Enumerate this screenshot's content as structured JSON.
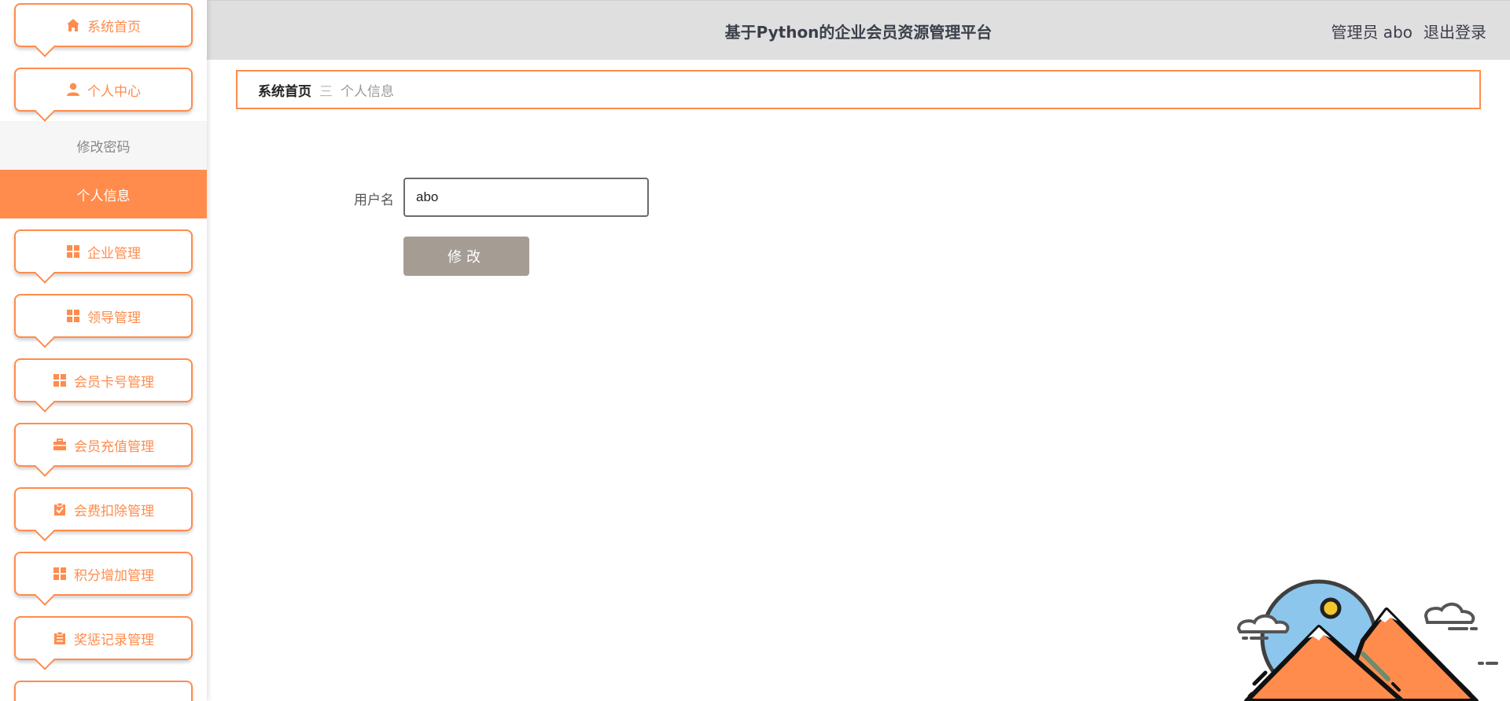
{
  "sidebar": {
    "items": [
      {
        "label": "系统首页",
        "icon": "home-icon"
      },
      {
        "label": "个人中心",
        "icon": "user-icon"
      },
      {
        "label": "企业管理",
        "icon": "grid-icon"
      },
      {
        "label": "领导管理",
        "icon": "grid-icon"
      },
      {
        "label": "会员卡号管理",
        "icon": "grid-icon"
      },
      {
        "label": "会员充值管理",
        "icon": "briefcase-icon"
      },
      {
        "label": "会费扣除管理",
        "icon": "clipboard-check-icon"
      },
      {
        "label": "积分增加管理",
        "icon": "grid-icon"
      },
      {
        "label": "奖惩记录管理",
        "icon": "clipboard-icon"
      }
    ],
    "subitems": [
      {
        "label": "修改密码",
        "active": false
      },
      {
        "label": "个人信息",
        "active": true
      }
    ]
  },
  "header": {
    "title": "基于Python的企业会员资源管理平台",
    "user": "管理员 abo",
    "logout": "退出登录"
  },
  "breadcrumb": {
    "home": "系统首页",
    "separator": "三",
    "current": "个人信息"
  },
  "form": {
    "username_label": "用户名",
    "username_value": "abo",
    "submit_label": "修改"
  },
  "colors": {
    "accent": "#ff8c4d",
    "header_bg": "#e0dfe0",
    "button_bg": "#a59c94"
  }
}
